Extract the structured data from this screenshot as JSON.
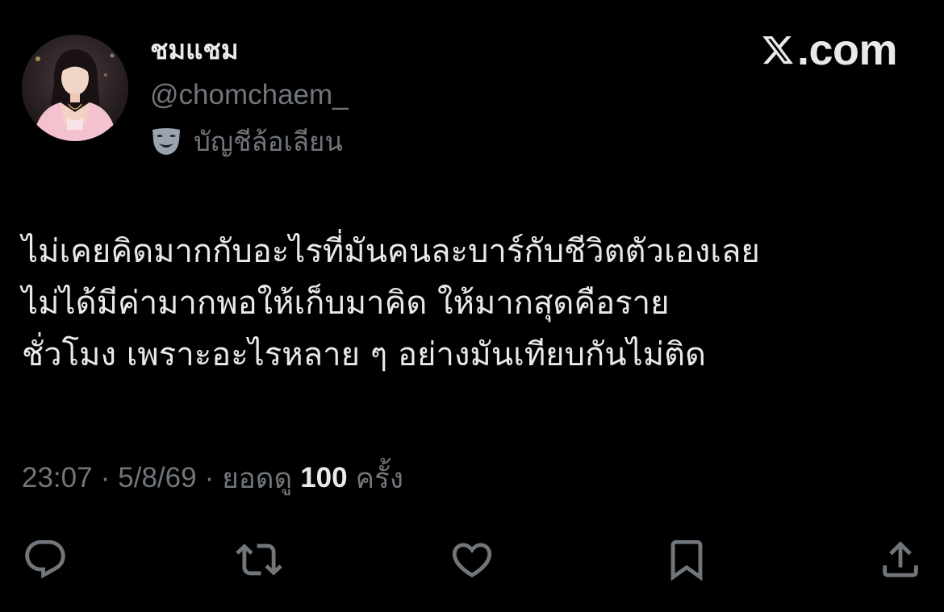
{
  "brand": {
    "logo_icon": "x-logo-icon",
    "text": ".com"
  },
  "author": {
    "display_name": "ชมแชม",
    "handle": "@chomchaem_",
    "parody_label": "บัญชีล้อเลียน",
    "parody_icon": "theater-mask-icon"
  },
  "tweet": {
    "lines": [
      "ไม่เคยคิดมากกับอะไรที่มันคนละบาร์กับชีวิตตัวเองเลย",
      "ไม่ได้มีค่ามากพอให้เก็บมาคิด ให้มากสุดคือราย",
      "ชั่วโมง เพราะอะไรหลาย ๆ อย่างมันเทียบกันไม่ติด"
    ]
  },
  "meta": {
    "time": "23:07",
    "separator": "·",
    "date": "5/8/69",
    "views_prefix": "ยอดดู",
    "views_count": "100",
    "views_suffix": "ครั้ง"
  },
  "actions": [
    {
      "name": "reply",
      "icon": "reply-icon"
    },
    {
      "name": "retweet",
      "icon": "retweet-icon"
    },
    {
      "name": "like",
      "icon": "heart-icon"
    },
    {
      "name": "bookmark",
      "icon": "bookmark-icon"
    },
    {
      "name": "share",
      "icon": "share-icon"
    }
  ],
  "colors": {
    "background": "#000000",
    "primary_text": "#e7e9ea",
    "secondary_text": "#71767b"
  }
}
